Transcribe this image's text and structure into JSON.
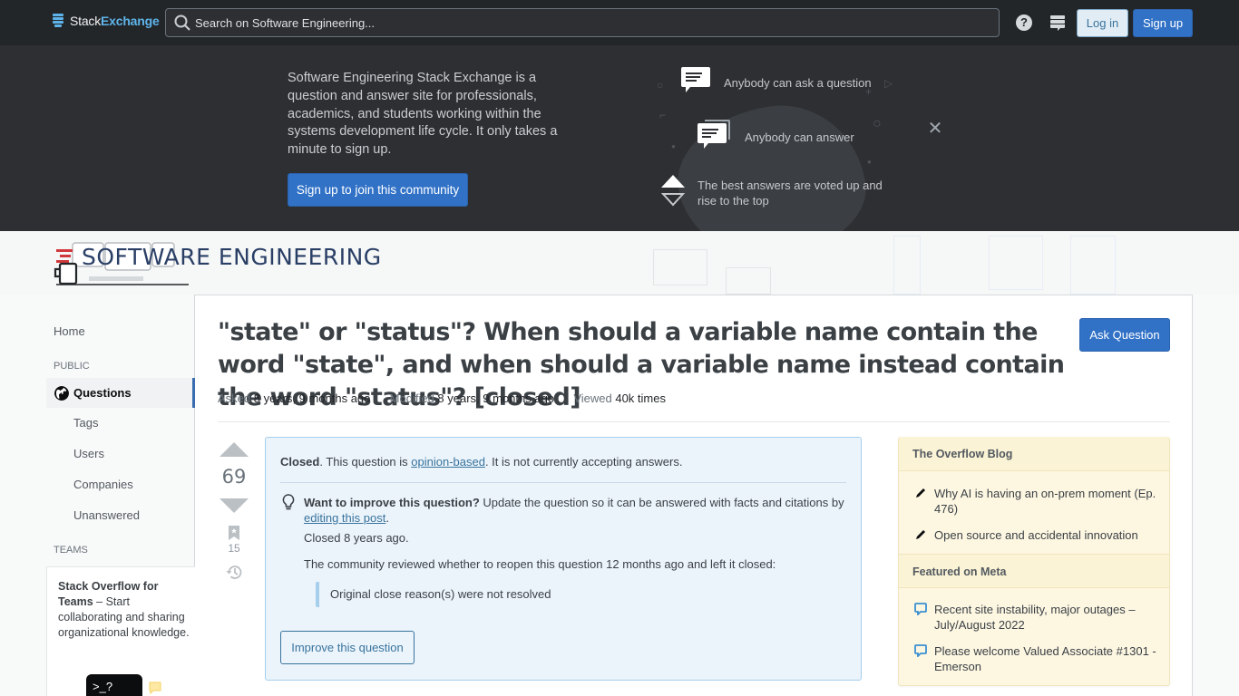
{
  "topbar": {
    "logo_stack": "Stack",
    "logo_exchange": "Exchange",
    "search_placeholder": "Search on Software Engineering...",
    "help_icon_glyph": "?",
    "login_label": "Log in",
    "signup_label": "Sign up"
  },
  "banner": {
    "description": "Software Engineering Stack Exchange is a question and answer site for professionals, academics, and students working within the systems development life cycle. It only takes a minute to sign up.",
    "join_button": "Sign up to join this community",
    "features": [
      {
        "icon": "speech-bubble-icon",
        "text": "Anybody can ask a question"
      },
      {
        "icon": "speech-bubbles-icon",
        "text": "Anybody can answer"
      },
      {
        "icon": "vote-arrows-icon",
        "text": "The best answers are voted up and rise to the top"
      }
    ],
    "close_glyph": "✕"
  },
  "site": {
    "name": "SOFTWARE ENGINEERING"
  },
  "leftnav": {
    "home": "Home",
    "public_label": "PUBLIC",
    "questions": "Questions",
    "tags": "Tags",
    "users": "Users",
    "companies": "Companies",
    "unanswered": "Unanswered",
    "teams_label": "TEAMS",
    "teams_title": "Stack Overflow for Teams",
    "teams_desc": " – Start collaborating and sharing organizational knowledge.",
    "teams_prompt": ">_?"
  },
  "question": {
    "title": "\"state\" or \"status\"? When should a variable name contain the word \"state\", and when should a variable name instead contain the word \"status\"? [closed]",
    "ask_button": "Ask Question",
    "asked_label": "Asked",
    "asked_value": "8 years, 9 months ago",
    "modified_label": "Modified",
    "modified_value": "8 years, 9 months ago",
    "viewed_label": "Viewed",
    "viewed_value": "40k times",
    "votes": "69",
    "bookmarks": "15"
  },
  "notice": {
    "closed_bold": "Closed",
    "closed_text1": ". This question is ",
    "closed_link": "opinion-based",
    "closed_text2": ". It is not currently accepting answers.",
    "improve_bold": "Want to improve this question?",
    "improve_text": " Update the question so it can be answered with facts and citations by ",
    "improve_link": "editing this post",
    "improve_end": ".",
    "closed_ago": "Closed 8 years ago.",
    "review_text": "The community reviewed whether to reopen this question 12 months ago and left it closed:",
    "quote": "Original close reason(s) were not resolved",
    "improve_button": "Improve this question"
  },
  "sidebar": {
    "blog_header": "The Overflow Blog",
    "blog_items": [
      "Why AI is having an on-prem moment (Ep. 476)",
      "Open source and accidental innovation"
    ],
    "meta_header": "Featured on Meta",
    "meta_items": [
      "Recent site instability, major outages – July/August 2022",
      "Please welcome Valued Associate #1301 - Emerson"
    ]
  },
  "colors": {
    "accent": "#3172c7",
    "topbar_bg": "#232629",
    "banner_bg": "#2d2f32",
    "notice_bg": "#ebf4fb",
    "widget_bg": "#fdf7e2"
  }
}
